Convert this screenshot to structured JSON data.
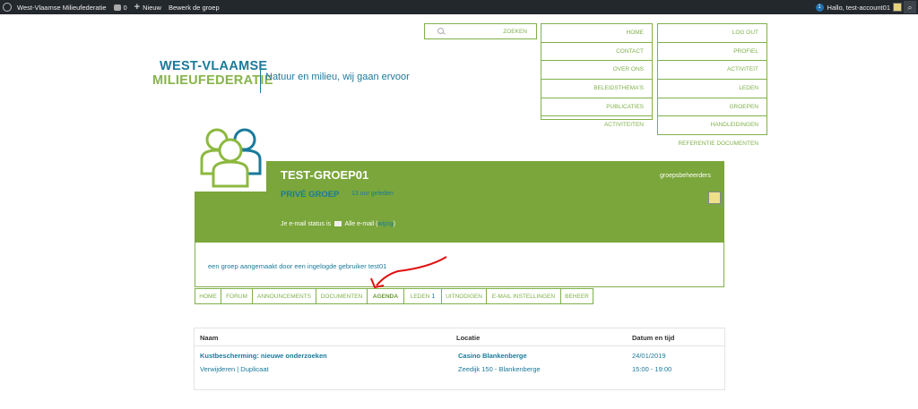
{
  "adminbar": {
    "site_name": "West-Vlaamse Milieufederatie",
    "comments_count": "0",
    "new_label": "Nieuw",
    "edit_label": "Bewerk de groep",
    "notification_count": "1",
    "greeting": "Hallo, test-account01"
  },
  "logo": {
    "line1": "WEST-VLAAMSE",
    "line2": "MILIEUFEDERATIE",
    "tagline": "Natuur en milieu, wij gaan ervoor"
  },
  "search": {
    "label": "ZOEKEN"
  },
  "menu1": [
    "HOME",
    "CONTACT",
    "OVER ONS",
    "BELEIDSTHEMA'S",
    "PUBLICATIES",
    "ACTIVITEITEN"
  ],
  "menu2": [
    "LOG OUT",
    "PROFIEL",
    "ACTIVITEIT",
    "LEDEN",
    "GROEPEN",
    "HANDLEIDINGEN",
    "REFERENTIE DOCUMENTEN"
  ],
  "group": {
    "title": "TEST-GROEP01",
    "type": "PRIVÉ GROEP",
    "time_ago": "13 uur geleden",
    "admins_label": "groepsbeheerders",
    "email_status_label": "Je e-mail status is",
    "email_status_value": "Alle e-mail (",
    "email_status_link": "wijzig",
    "email_status_end": ")",
    "description": "een groep aangemaakt door een ingelogde gebruiker test01"
  },
  "tabs": [
    {
      "label": "HOME"
    },
    {
      "label": "FORUM"
    },
    {
      "label": "ANNOUNCEMENTS"
    },
    {
      "label": "DOCUMENTEN"
    },
    {
      "label": "AGENDA"
    },
    {
      "label": "LEDEN",
      "count": "1"
    },
    {
      "label": "UITNODIGEN"
    },
    {
      "label": "E-MAIL INSTELLINGEN"
    },
    {
      "label": "BEHEER"
    }
  ],
  "table": {
    "headers": [
      "Naam",
      "Locatie",
      "Datum en tijd"
    ],
    "rows": [
      {
        "name": "Kustbescherming: nieuwe onderzoeken",
        "actions": "Verwijderen | Duplicaat",
        "location": "Casino Blankenberge",
        "address": "Zeedijk 150 - Blankenberge",
        "date": "24/01/2019",
        "time": "15:00 - 19:00"
      }
    ]
  }
}
